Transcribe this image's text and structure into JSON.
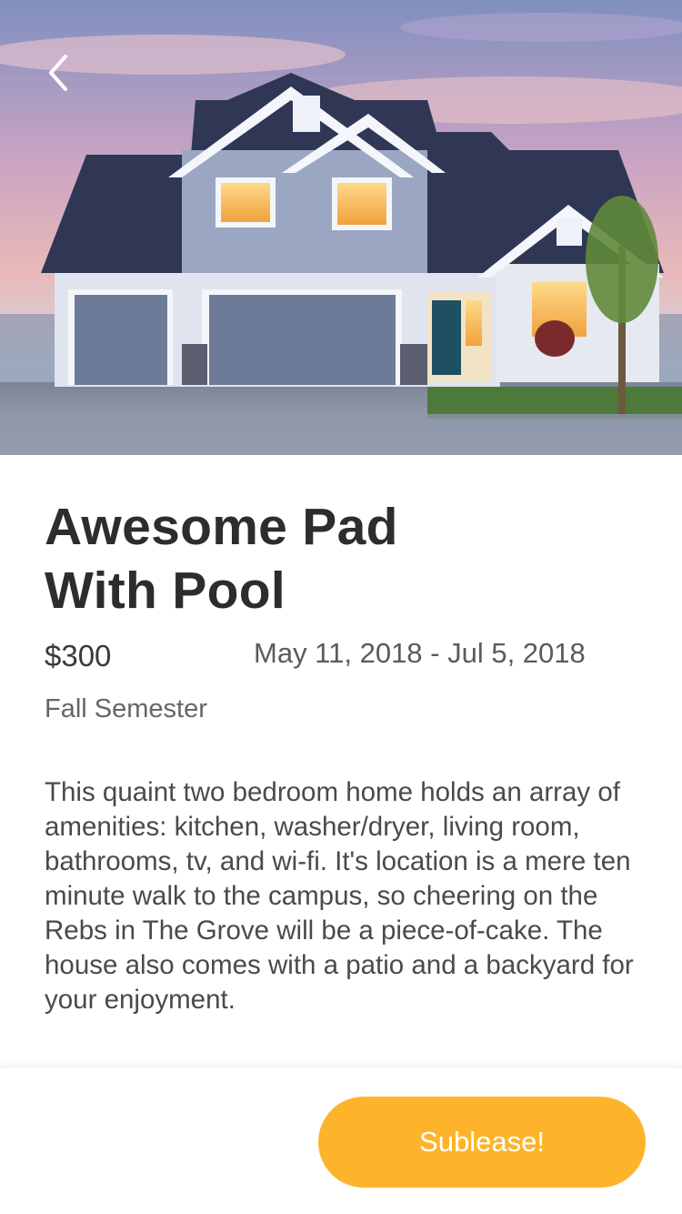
{
  "listing": {
    "title": "Awesome Pad With Pool",
    "price": "$300",
    "dates": "May 11, 2018 - Jul 5, 2018",
    "term": "Fall Semester",
    "description": "This quaint two bedroom home holds an array of amenities: kitchen, washer/dryer, living room, bathrooms, tv, and wi-fi. It's location is a mere ten minute walk to the campus, so cheering on the Rebs in The Grove will be a piece-of-cake. The house also comes with a patio and a backyard for your enjoyment."
  },
  "actions": {
    "back_icon": "chevron-left-icon",
    "sublease_label": "Sublease!"
  },
  "colors": {
    "accent": "#fdb42a",
    "title": "#2d2d2d",
    "body_text": "#4a4a4a"
  }
}
